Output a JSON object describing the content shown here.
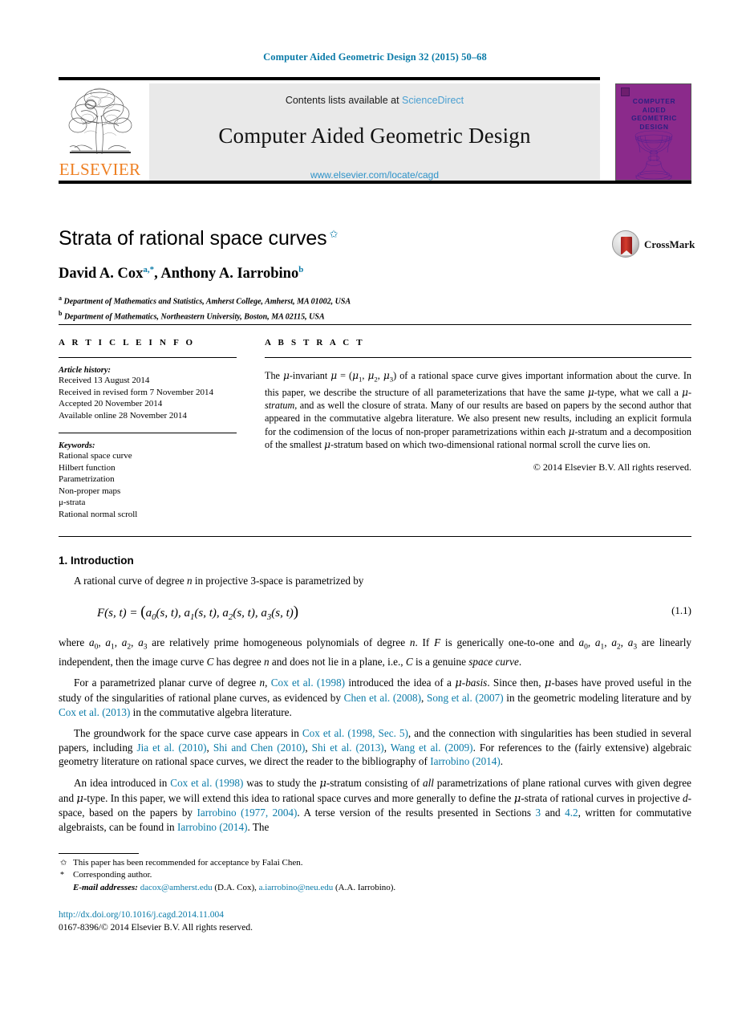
{
  "running_head": "Computer Aided Geometric Design 32 (2015) 50–68",
  "banner": {
    "publisher": "ELSEVIER",
    "publisher_logo_icon": "elsevier-tree-logo",
    "contents_prefix": "Contents lists available at",
    "contents_link": "ScienceDirect",
    "journal_name": "Computer Aided Geometric Design",
    "journal_url": "www.elsevier.com/locate/cagd",
    "cover": {
      "line1": "COMPUTER",
      "line2": "AIDED",
      "line3": "GEOMETRIC",
      "line4": "DESIGN",
      "bg_color": "#8b2a8b",
      "text_color": "#2b1f80",
      "art_icon": "wireframe-goblet-icon"
    },
    "link_color": "#4a9fd1"
  },
  "title": {
    "text": "Strata of rational space curves",
    "footnote_mark": "✩"
  },
  "authors": {
    "name1": "David A. Cox",
    "sup1": "a,*",
    "separator": ", ",
    "name2": "Anthony A. Iarrobino",
    "sup2": "b"
  },
  "affiliations": [
    {
      "mark": "a",
      "text": "Department of Mathematics and Statistics, Amherst College, Amherst, MA 01002, USA"
    },
    {
      "mark": "b",
      "text": "Department of Mathematics, Northeastern University, Boston, MA 02115, USA"
    }
  ],
  "crossmark": {
    "label": "CrossMark",
    "icon": "crossmark-logo-icon"
  },
  "article_info": {
    "heading": "A R T I C L E   I N F O",
    "history_label": "Article history:",
    "history": [
      "Received 13 August 2014",
      "Received in revised form 7 November 2014",
      "Accepted 20 November 2014",
      "Available online 28 November 2014"
    ],
    "keywords_label": "Keywords:",
    "keywords": [
      "Rational space curve",
      "Hilbert function",
      "Parametrization",
      "Non-proper maps",
      "μ-strata",
      "Rational normal scroll"
    ]
  },
  "abstract": {
    "heading": "A B S T R A C T",
    "copyright": "© 2014 Elsevier B.V. All rights reserved."
  },
  "body": {
    "section1_heading": "1. Introduction",
    "equation_number": "(1.1)",
    "citations": {
      "cox1998": "Cox et al. (1998)",
      "chen2008": "Chen et al. (2008)",
      "song2007": "Song et al. (2007)",
      "cox2013": "Cox et al. (2013)",
      "cox1998sec5": "Cox et al. (1998, Sec. 5)",
      "jia2010": "Jia et al. (2010)",
      "shichen2010": "Shi and Chen (2010)",
      "shi2013": "Shi et al. (2013)",
      "wang2009": "Wang et al. (2009)",
      "iarrobino2014": "Iarrobino (2014)",
      "iarrobino19772004": "Iarrobino (1977, 2004)",
      "sec3": "3",
      "sec42": "4.2"
    }
  },
  "footnotes": {
    "star_mark": "✩",
    "star_text": "This paper has been recommended for acceptance by Falai Chen.",
    "corr_mark": "*",
    "corr_text": "Corresponding author.",
    "emails_label": "E-mail addresses:",
    "email1": "dacox@amherst.edu",
    "email1_owner": "(D.A. Cox),",
    "email2": "a.iarrobino@neu.edu",
    "email2_owner": "(A.A. Iarrobino)."
  },
  "doi": {
    "url": "http://dx.doi.org/10.1016/j.cagd.2014.11.004",
    "issn_line": "0167-8396/© 2014 Elsevier B.V. All rights reserved."
  },
  "colors": {
    "link_blue": "#0b7ba8",
    "light_blue": "#4a9fd1",
    "elsevier_orange": "#ee7f22",
    "cover_purple": "#8b2a8b"
  }
}
